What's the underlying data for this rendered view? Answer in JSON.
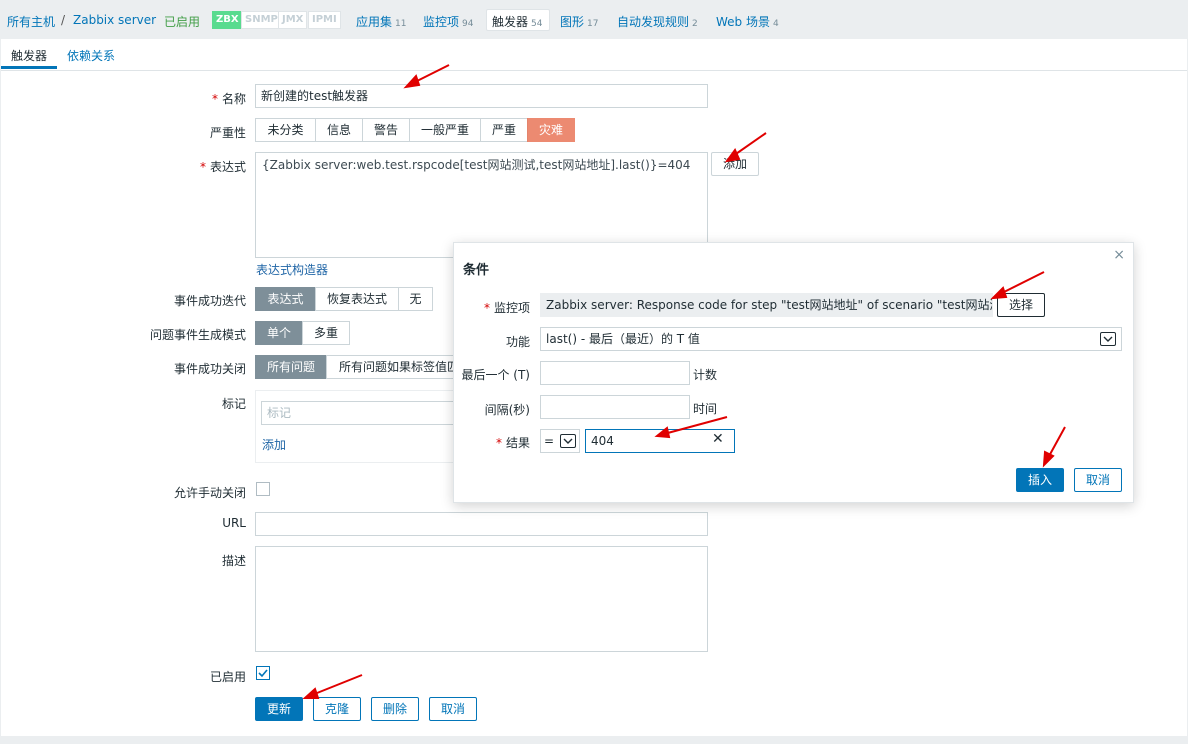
{
  "breadcrumb": {
    "all_hosts": "所有主机",
    "separator": "/",
    "host": "Zabbix server",
    "status": "已启用"
  },
  "badges": [
    "ZBX",
    "SNMP",
    "JMX",
    "IPMI"
  ],
  "host_nav": [
    {
      "label": "应用集",
      "count": "11"
    },
    {
      "label": "监控项",
      "count": "94"
    },
    {
      "label": "触发器",
      "count": "54"
    },
    {
      "label": "图形",
      "count": "17"
    },
    {
      "label": "自动发现规则",
      "count": "2"
    },
    {
      "label": "Web 场景",
      "count": "4"
    }
  ],
  "tabs": [
    "触发器",
    "依赖关系"
  ],
  "form": {
    "name_label": "名称",
    "name_value": "新创建的test触发器",
    "severity_label": "严重性",
    "severity_options": [
      "未分类",
      "信息",
      "警告",
      "一般严重",
      "严重",
      "灾难"
    ],
    "expression_label": "表达式",
    "expression_value": "{Zabbix server:web.test.rspcode[test网站测试,test网站地址].last()}=404",
    "add_button": "添加",
    "expression_builder": "表达式构造器",
    "ok_event_label": "事件成功迭代",
    "ok_event_options": [
      "表达式",
      "恢复表达式",
      "无"
    ],
    "problem_mode_label": "问题事件生成模式",
    "problem_mode_options": [
      "单个",
      "多重"
    ],
    "ok_close_label": "事件成功关闭",
    "ok_close_options": [
      "所有问题",
      "所有问题如果标签值匹"
    ],
    "tags_label": "标记",
    "tags_placeholder": "标记",
    "tags_add": "添加",
    "manual_close_label": "允许手动关闭",
    "url_label": "URL",
    "description_label": "描述",
    "enabled_label": "已启用",
    "buttons": [
      "更新",
      "克隆",
      "删除",
      "取消"
    ]
  },
  "modal": {
    "title": "条件",
    "close": "×",
    "item_label": "监控项",
    "item_value": "Zabbix server: Response code for step \"test网站地址\" of scenario \"test网站测试\".",
    "select_button": "选择",
    "function_label": "功能",
    "function_value": "last() - 最后（最近）的 T 值",
    "last_label": "最后一个 (T)",
    "last_unit": "计数",
    "interval_label": "间隔(秒)",
    "interval_unit": "时间",
    "result_label": "结果",
    "operator": "=",
    "result_value": "404",
    "clear": "✕",
    "insert_button": "插入",
    "cancel_button": "取消"
  },
  "colors": {
    "link": "#0275b8",
    "primary": "#0275b8",
    "required": "#d40000",
    "arrow": "#e00000",
    "disaster": "#e97659",
    "selected_segment": "#7e8f99",
    "zbx_badge": "#59db8f"
  }
}
